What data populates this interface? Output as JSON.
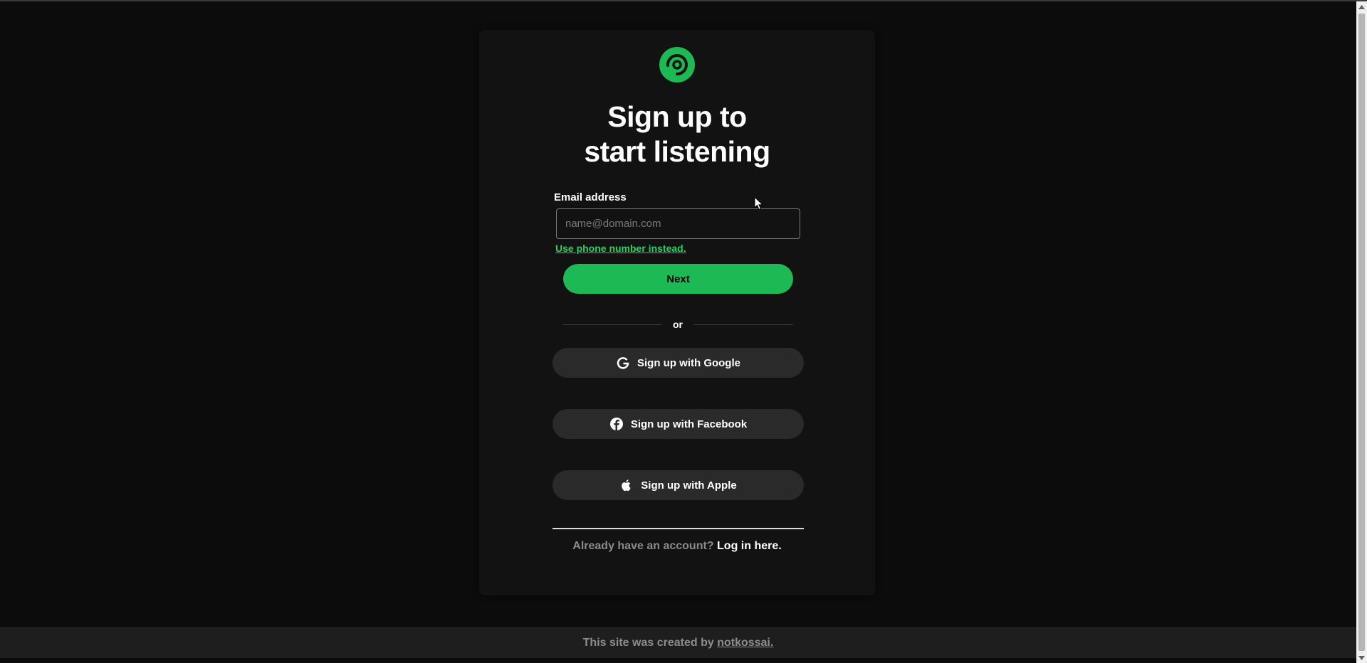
{
  "colors": {
    "accent": "#1db954",
    "link_green": "#1ed760",
    "background": "#0c0c0c",
    "card": "#121212",
    "social_button": "#2a2a2a"
  },
  "signup": {
    "title_line1": "Sign up to",
    "title_line2": "start listening",
    "email_label": "Email address",
    "email_placeholder": "name@domain.com",
    "email_value": "",
    "phone_link": "Use phone number instead.",
    "next_label": "Next",
    "divider_text": "or",
    "social": [
      {
        "label": "Sign up with Google",
        "icon": "google-icon"
      },
      {
        "label": "Sign up with Facebook",
        "icon": "facebook-icon"
      },
      {
        "label": "Sign up with Apple",
        "icon": "apple-icon"
      }
    ],
    "login_prompt": "Already have an account?",
    "login_link": "Log in here."
  },
  "footer": {
    "text": "This site was created by",
    "author_link": "notkossai."
  }
}
